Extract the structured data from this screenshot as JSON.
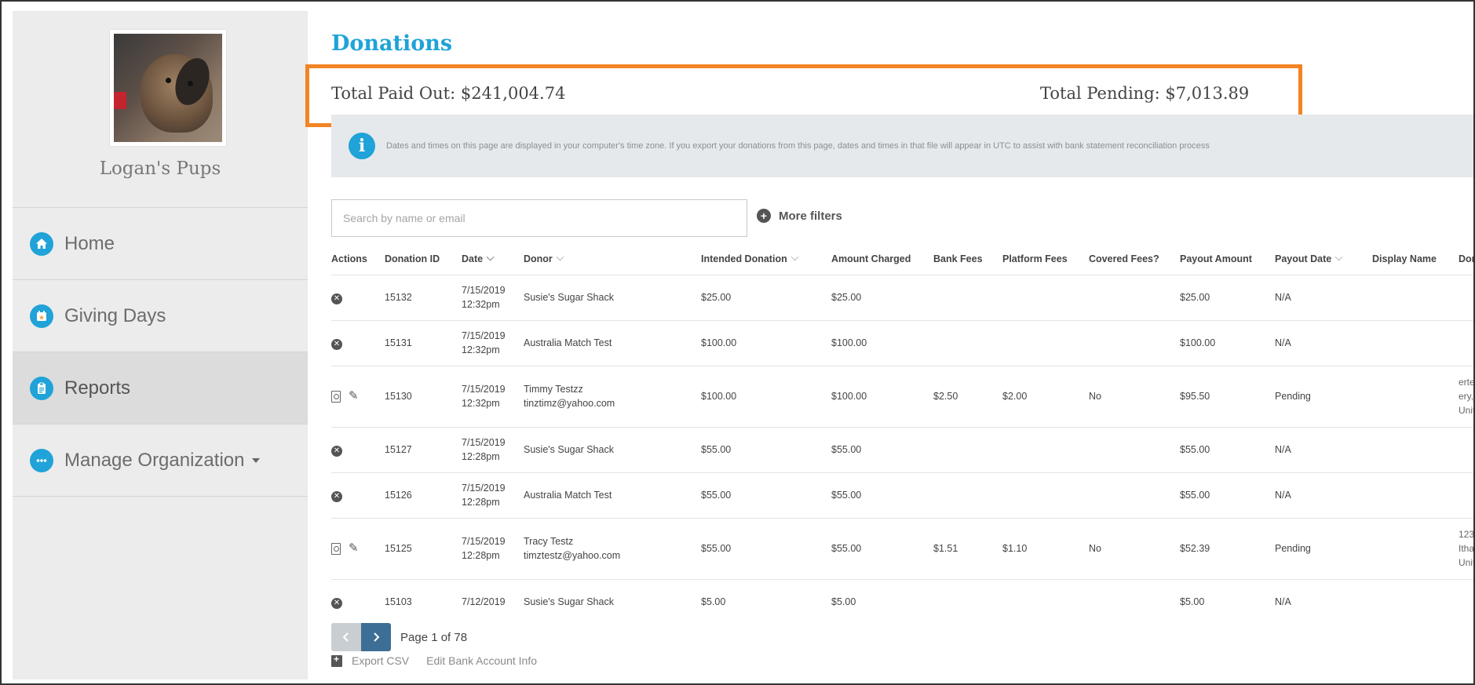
{
  "sidebar": {
    "org_name": "Logan's Pups",
    "items": [
      {
        "label": "Home",
        "icon": "home-icon",
        "active": false
      },
      {
        "label": "Giving Days",
        "icon": "calendar-star-icon",
        "active": false
      },
      {
        "label": "Reports",
        "icon": "clipboard-icon",
        "active": true
      },
      {
        "label": "Manage Organization",
        "icon": "ellipsis-icon",
        "active": false
      }
    ]
  },
  "main": {
    "title": "Donations",
    "total_paid": "Total Paid Out: $241,004.74",
    "total_pending": "Total Pending: $7,013.89",
    "info_text": "Dates and times on this page are displayed in your computer's time zone. If you export your donations from this page, dates and times in that file will appear in UTC to assist with bank statement reconciliation process",
    "search_placeholder": "Search by name or email",
    "more_filters": "More filters"
  },
  "table": {
    "headers": {
      "actions": "Actions",
      "donation_id": "Donation ID",
      "date": "Date",
      "donor": "Donor",
      "intended": "Intended Donation",
      "charged": "Amount Charged",
      "bank_fees": "Bank Fees",
      "platform_fees": "Platform Fees",
      "covered": "Covered Fees?",
      "payout_amount": "Payout Amount",
      "payout_date": "Payout Date",
      "display_name": "Display Name",
      "donor_address": "Dor"
    },
    "rows": [
      {
        "action": "cancel",
        "id": "15132",
        "date": "7/15/2019",
        "time": "12:32pm",
        "donor": "Susie's Sugar Shack",
        "email": "",
        "intended": "$25.00",
        "charged": "$25.00",
        "bank_fees": "",
        "platform_fees": "",
        "covered": "",
        "payout": "$25.00",
        "payout_date": "N/A",
        "display_name": "",
        "addr1": "",
        "addr2": "",
        "addr3": ""
      },
      {
        "action": "cancel",
        "id": "15131",
        "date": "7/15/2019",
        "time": "12:32pm",
        "donor": "Australia Match Test",
        "email": "",
        "intended": "$100.00",
        "charged": "$100.00",
        "bank_fees": "",
        "platform_fees": "",
        "covered": "",
        "payout": "$100.00",
        "payout_date": "N/A",
        "display_name": "",
        "addr1": "",
        "addr2": "",
        "addr3": ""
      },
      {
        "action": "edit",
        "id": "15130",
        "date": "7/15/2019",
        "time": "12:32pm",
        "donor": "Timmy Testzz",
        "email": "tinztimz@yahoo.com",
        "intended": "$100.00",
        "charged": "$100.00",
        "bank_fees": "$2.50",
        "platform_fees": "$2.00",
        "covered": "No",
        "payout": "$95.50",
        "payout_date": "Pending",
        "display_name": "",
        "addr1": "erte",
        "addr2": "ery,",
        "addr3": "Unit"
      },
      {
        "action": "cancel",
        "id": "15127",
        "date": "7/15/2019",
        "time": "12:28pm",
        "donor": "Susie's Sugar Shack",
        "email": "",
        "intended": "$55.00",
        "charged": "$55.00",
        "bank_fees": "",
        "platform_fees": "",
        "covered": "",
        "payout": "$55.00",
        "payout_date": "N/A",
        "display_name": "",
        "addr1": "",
        "addr2": "",
        "addr3": ""
      },
      {
        "action": "cancel",
        "id": "15126",
        "date": "7/15/2019",
        "time": "12:28pm",
        "donor": "Australia Match Test",
        "email": "",
        "intended": "$55.00",
        "charged": "$55.00",
        "bank_fees": "",
        "platform_fees": "",
        "covered": "",
        "payout": "$55.00",
        "payout_date": "N/A",
        "display_name": "",
        "addr1": "",
        "addr2": "",
        "addr3": ""
      },
      {
        "action": "edit",
        "id": "15125",
        "date": "7/15/2019",
        "time": "12:28pm",
        "donor": "Tracy Testz",
        "email": "timztestz@yahoo.com",
        "intended": "$55.00",
        "charged": "$55.00",
        "bank_fees": "$1.51",
        "platform_fees": "$1.10",
        "covered": "No",
        "payout": "$52.39",
        "payout_date": "Pending",
        "display_name": "",
        "addr1": "123",
        "addr2": "Itha",
        "addr3": "Unit"
      },
      {
        "action": "cancel",
        "id": "15103",
        "date": "7/12/2019",
        "time": "",
        "donor": "Susie's Sugar Shack",
        "email": "",
        "intended": "$5.00",
        "charged": "$5.00",
        "bank_fees": "",
        "platform_fees": "",
        "covered": "",
        "payout": "$5.00",
        "payout_date": "N/A",
        "display_name": "",
        "addr1": "",
        "addr2": "",
        "addr3": ""
      }
    ]
  },
  "pager": {
    "text": "Page 1 of 78"
  },
  "footer": {
    "export_csv": "Export CSV",
    "edit_bank": "Edit Bank Account Info"
  },
  "colors": {
    "accent": "#1fa3d8",
    "highlight_border": "#f28424",
    "pager_active": "#3d6e96"
  }
}
